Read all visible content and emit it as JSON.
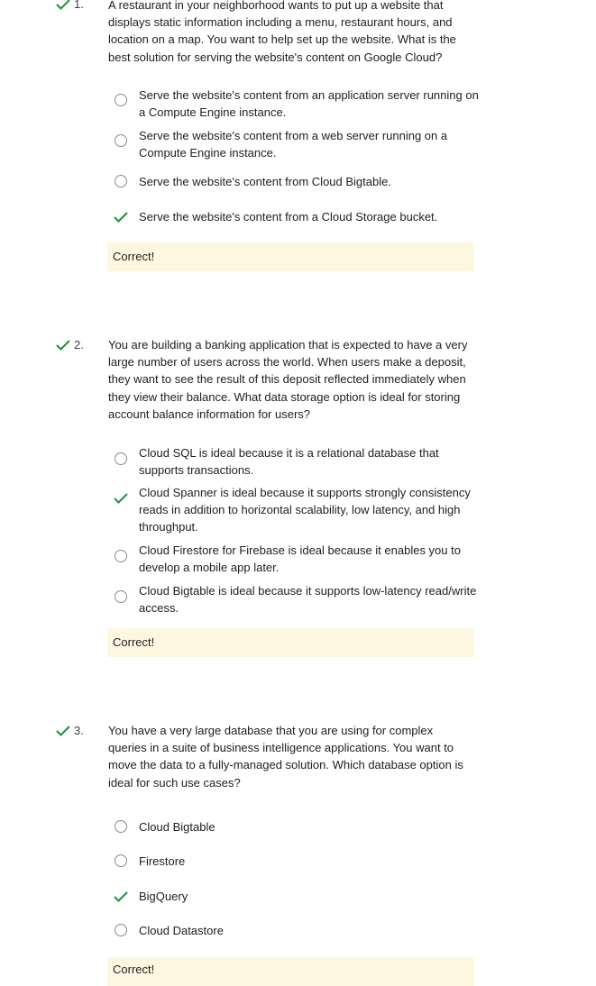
{
  "colors": {
    "check": "#1e8e3e",
    "feedback_bg": "#fef7e0",
    "radio_border": "#8a8a8a"
  },
  "questions": [
    {
      "number": "1.",
      "status_icon": "check-icon",
      "text": "A restaurant in your neighborhood wants to put up a website that displays static information including a menu, restaurant hours, and location on a map. You want to help set up the website. What is the best solution for serving the website's content on Google Cloud?",
      "options": [
        {
          "text": "Serve the website's content from an application server running on a Compute Engine instance.",
          "selected": false
        },
        {
          "text": "Serve the website's content from a web server running on a Compute Engine instance.",
          "selected": false
        },
        {
          "text": "Serve the website's content from Cloud Bigtable.",
          "selected": false
        },
        {
          "text": "Serve the website's content from a Cloud Storage bucket.",
          "selected": true
        }
      ],
      "feedback": "Correct!"
    },
    {
      "number": "2.",
      "status_icon": "check-icon",
      "text": "You are building a banking application that is expected to have a very large number of users across the world. When users make a deposit, they want to see the result of this deposit reflected immediately when they view their balance. What data storage option is ideal for storing account balance information for users?",
      "options": [
        {
          "text": "Cloud SQL is ideal because it is a relational database that supports transactions.",
          "selected": false
        },
        {
          "text": "Cloud Spanner is ideal because it supports strongly consistency reads in addition to horizontal scalability, low latency, and high throughput.",
          "selected": true
        },
        {
          "text": "Cloud Firestore for Firebase is ideal because it enables you to develop a mobile app later.",
          "selected": false
        },
        {
          "text": "Cloud Bigtable is ideal because it supports low-latency read/write access.",
          "selected": false
        }
      ],
      "feedback": "Correct!"
    },
    {
      "number": "3.",
      "status_icon": "check-icon",
      "text": "You have a very large database that you are using for complex queries in a suite of business intelligence applications. You want to move the data to a fully-managed solution. Which database option is ideal for such use cases?",
      "options": [
        {
          "text": "Cloud Bigtable",
          "selected": false
        },
        {
          "text": "Firestore",
          "selected": false
        },
        {
          "text": "BigQuery",
          "selected": true
        },
        {
          "text": "Cloud Datastore",
          "selected": false
        }
      ],
      "feedback": "Correct!"
    }
  ]
}
